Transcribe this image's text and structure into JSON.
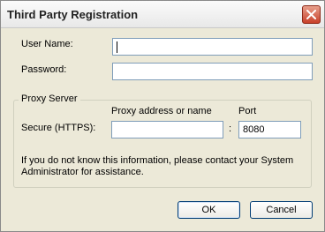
{
  "window": {
    "title": "Third Party Registration",
    "close_icon": "close-icon"
  },
  "form": {
    "username_label": "User Name:",
    "username_value": "",
    "password_label": "Password:",
    "password_value": ""
  },
  "proxy": {
    "group_label": "Proxy Server",
    "address_header": "Proxy address or name",
    "port_header": "Port",
    "secure_label": "Secure (HTTPS):",
    "address_value": "",
    "separator": ":",
    "port_value": "8080",
    "info_text_line1": "If you do not know this information, please contact your System",
    "info_text_line2": "Administrator for assistance."
  },
  "buttons": {
    "ok_label": "OK",
    "cancel_label": "Cancel"
  },
  "colors": {
    "dialog_bg": "#ece9d8",
    "close_button": "#c8402a",
    "input_border": "#7f9db9",
    "button_border": "#003c74"
  }
}
